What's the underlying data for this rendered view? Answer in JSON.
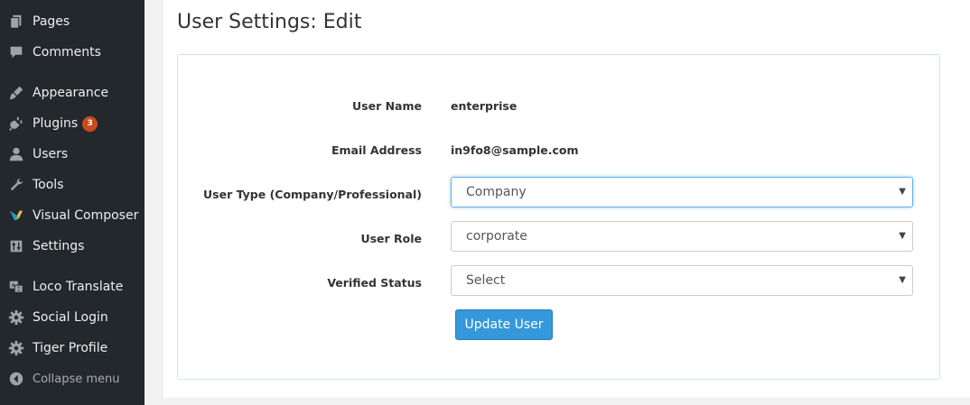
{
  "sidebar": {
    "items": [
      {
        "label": "Pages",
        "icon": "pages-icon"
      },
      {
        "label": "Comments",
        "icon": "comments-icon"
      },
      {
        "label": "Appearance",
        "icon": "appearance-icon"
      },
      {
        "label": "Plugins",
        "icon": "plugins-icon",
        "badge": "3"
      },
      {
        "label": "Users",
        "icon": "users-icon"
      },
      {
        "label": "Tools",
        "icon": "tools-icon"
      },
      {
        "label": "Visual Composer",
        "icon": "visual-composer-icon"
      },
      {
        "label": "Settings",
        "icon": "settings-icon"
      },
      {
        "label": "Loco Translate",
        "icon": "translate-icon"
      },
      {
        "label": "Social Login",
        "icon": "gear-icon"
      },
      {
        "label": "Tiger Profile",
        "icon": "gear-icon"
      }
    ],
    "collapse_label": "Collapse menu"
  },
  "page": {
    "title": "User Settings: Edit"
  },
  "form": {
    "user_name_label": "User Name",
    "user_name_value": "enterprise",
    "email_label": "Email Address",
    "email_value": "in9fo8@sample.com",
    "user_type_label": "User Type (Company/Professional)",
    "user_type_value": "Company",
    "user_role_label": "User Role",
    "user_role_value": "corporate",
    "verified_label": "Verified Status",
    "verified_value": "Select",
    "update_button_label": "Update User"
  },
  "colors": {
    "sidebar_bg": "#23282d",
    "badge": "#ca4a1f",
    "button": "#3498db",
    "panel_border": "#c9e6f2"
  }
}
